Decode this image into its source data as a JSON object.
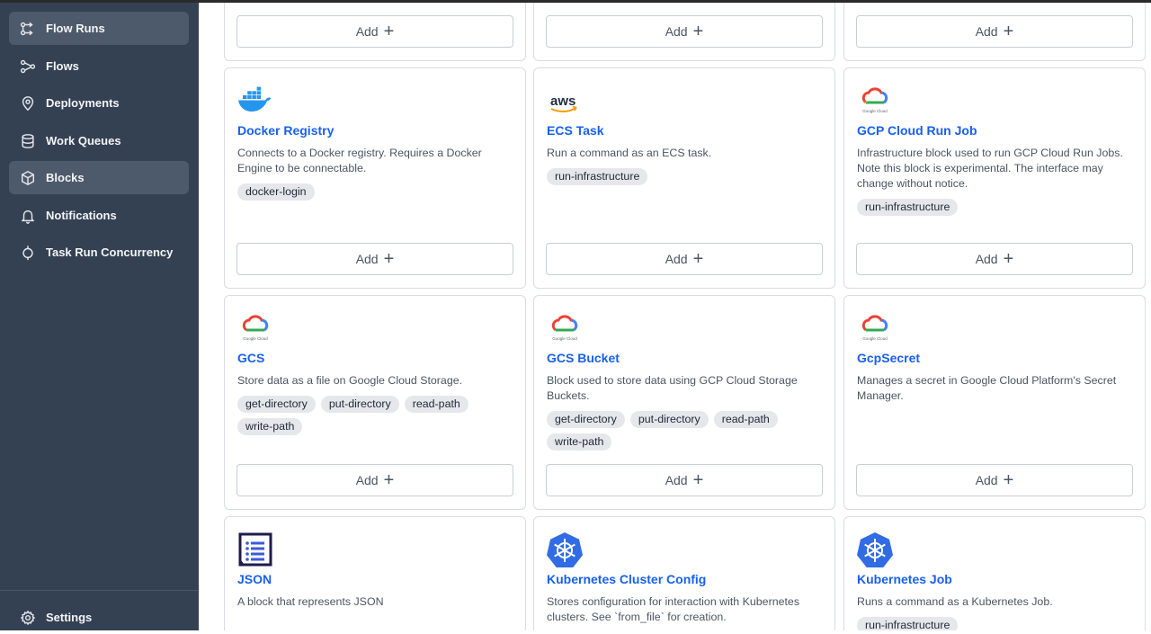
{
  "sidebar": {
    "items": [
      {
        "label": "Flow Runs",
        "icon": "flow-runs-icon",
        "active": true
      },
      {
        "label": "Flows",
        "icon": "flows-icon",
        "active": false
      },
      {
        "label": "Deployments",
        "icon": "location-pin-icon",
        "active": false
      },
      {
        "label": "Work Queues",
        "icon": "database-icon",
        "active": false
      },
      {
        "label": "Blocks",
        "icon": "cube-icon",
        "active": true
      },
      {
        "label": "Notifications",
        "icon": "bell-icon",
        "active": false
      },
      {
        "label": "Task Run Concurrency",
        "icon": "concurrency-icon",
        "active": false
      }
    ],
    "settings_label": "Settings"
  },
  "add_label": "Add",
  "cards": [
    {
      "title": "Docker Registry",
      "description": "Connects to a Docker registry. Requires a Docker Engine to be connectable.",
      "tags": [
        "docker-login"
      ],
      "logo": "docker-whale-logo"
    },
    {
      "title": "ECS Task",
      "description": "Run a command as an ECS task.",
      "tags": [
        "run-infrastructure"
      ],
      "logo": "aws-logo"
    },
    {
      "title": "GCP Cloud Run Job",
      "description": "Infrastructure block used to run GCP Cloud Run Jobs. Note this block is experimental. The interface may change without notice.",
      "tags": [
        "run-infrastructure"
      ],
      "logo": "google-cloud-logo"
    },
    {
      "title": "GCS",
      "description": "Store data as a file on Google Cloud Storage.",
      "tags": [
        "get-directory",
        "put-directory",
        "read-path",
        "write-path"
      ],
      "logo": "google-cloud-logo"
    },
    {
      "title": "GCS Bucket",
      "description": "Block used to store data using GCP Cloud Storage Buckets.",
      "tags": [
        "get-directory",
        "put-directory",
        "read-path",
        "write-path"
      ],
      "logo": "google-cloud-logo"
    },
    {
      "title": "GcpSecret",
      "description": "Manages a secret in Google Cloud Platform's Secret Manager.",
      "tags": [],
      "logo": "google-cloud-logo"
    },
    {
      "title": "JSON",
      "description": "A block that represents JSON",
      "tags": [],
      "logo": "json-list-logo"
    },
    {
      "title": "Kubernetes Cluster Config",
      "description": "Stores configuration for interaction with Kubernetes clusters. See `from_file` for creation.",
      "tags": [],
      "logo": "kubernetes-logo"
    },
    {
      "title": "Kubernetes Job",
      "description": "Runs a command as a Kubernetes Job.",
      "tags": [
        "run-infrastructure"
      ],
      "logo": "kubernetes-logo"
    }
  ],
  "google_cloud_caption": "Google Cloud",
  "aws_text": "aws"
}
